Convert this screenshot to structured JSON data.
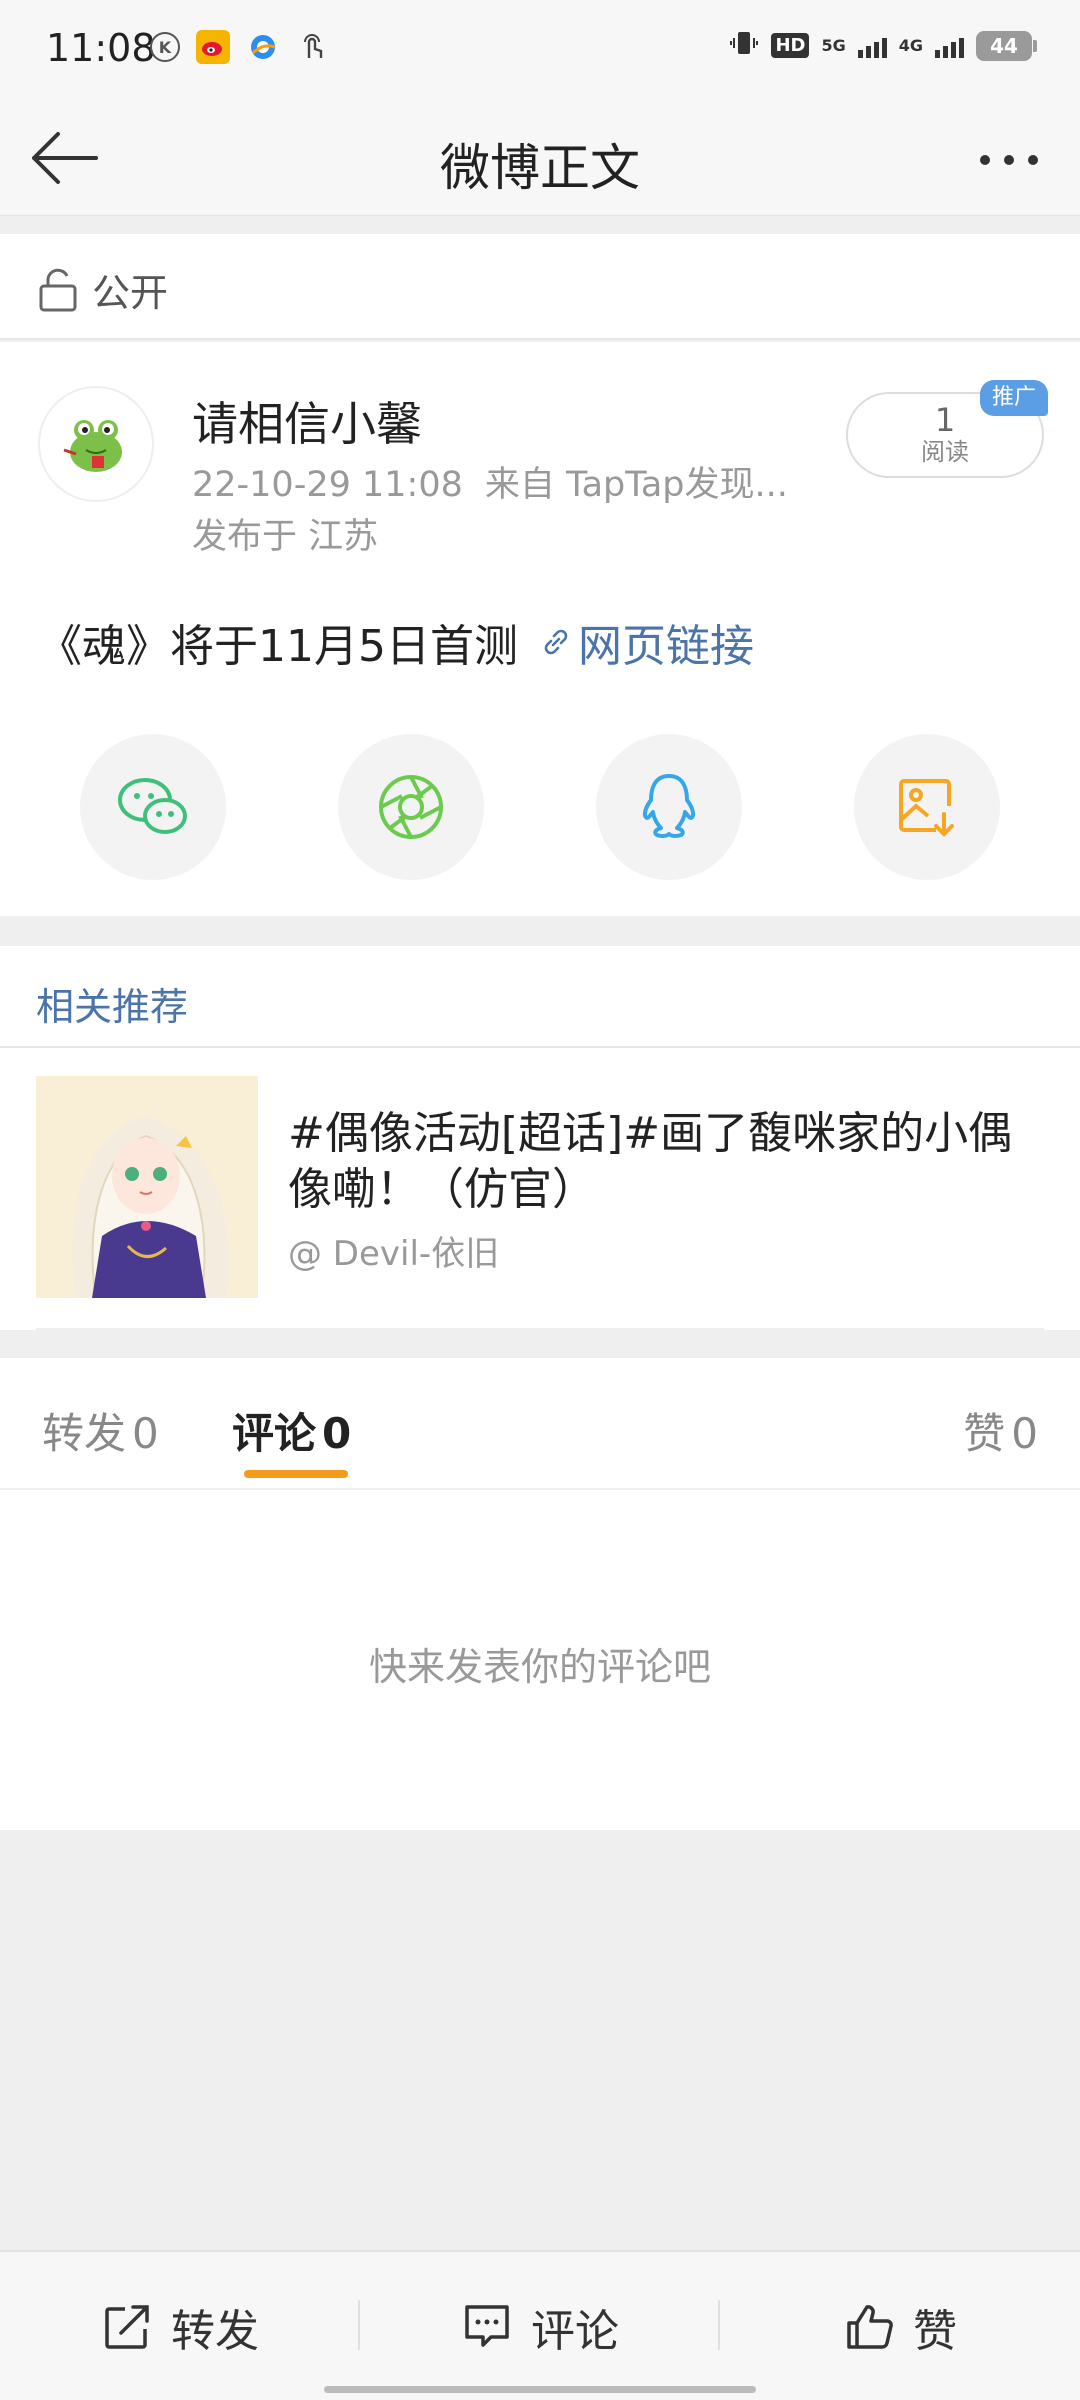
{
  "status_bar": {
    "time": "11:08",
    "network": "HD",
    "signal_1": "5G",
    "signal_2": "4G",
    "battery": "44"
  },
  "header": {
    "title": "微博正文"
  },
  "privacy": {
    "label": "公开"
  },
  "post": {
    "username": "请相信小馨",
    "timestamp": "22-10-29 11:08",
    "source": "来自 TapTap发现...",
    "location": "发布于 江苏",
    "read_count": "1",
    "read_label": "阅读",
    "promo_badge": "推广",
    "text": "《魂》将于11月5日首测",
    "link_label": "网页链接",
    "share_buttons": [
      {
        "icon": "wechat-icon",
        "color": "#3fc07a"
      },
      {
        "icon": "moments-icon",
        "color": "#6ccb4e"
      },
      {
        "icon": "qq-icon",
        "color": "#36a7e6"
      },
      {
        "icon": "save-image-icon",
        "color": "#f5a623"
      }
    ]
  },
  "related": {
    "title": "相关推荐",
    "item_title": "#偶像活动[超话]#画了馥咪家的小偶像嘞！（仿官）",
    "item_author": "@ Devil-依旧"
  },
  "tabs": {
    "repost_label": "转发",
    "repost_count": "0",
    "comment_label": "评论",
    "comment_count": "0",
    "like_label": "赞",
    "like_count": "0"
  },
  "comments": {
    "empty_text": "快来发表你的评论吧"
  },
  "bottom_bar": {
    "repost": "转发",
    "comment": "评论",
    "like": "赞"
  }
}
